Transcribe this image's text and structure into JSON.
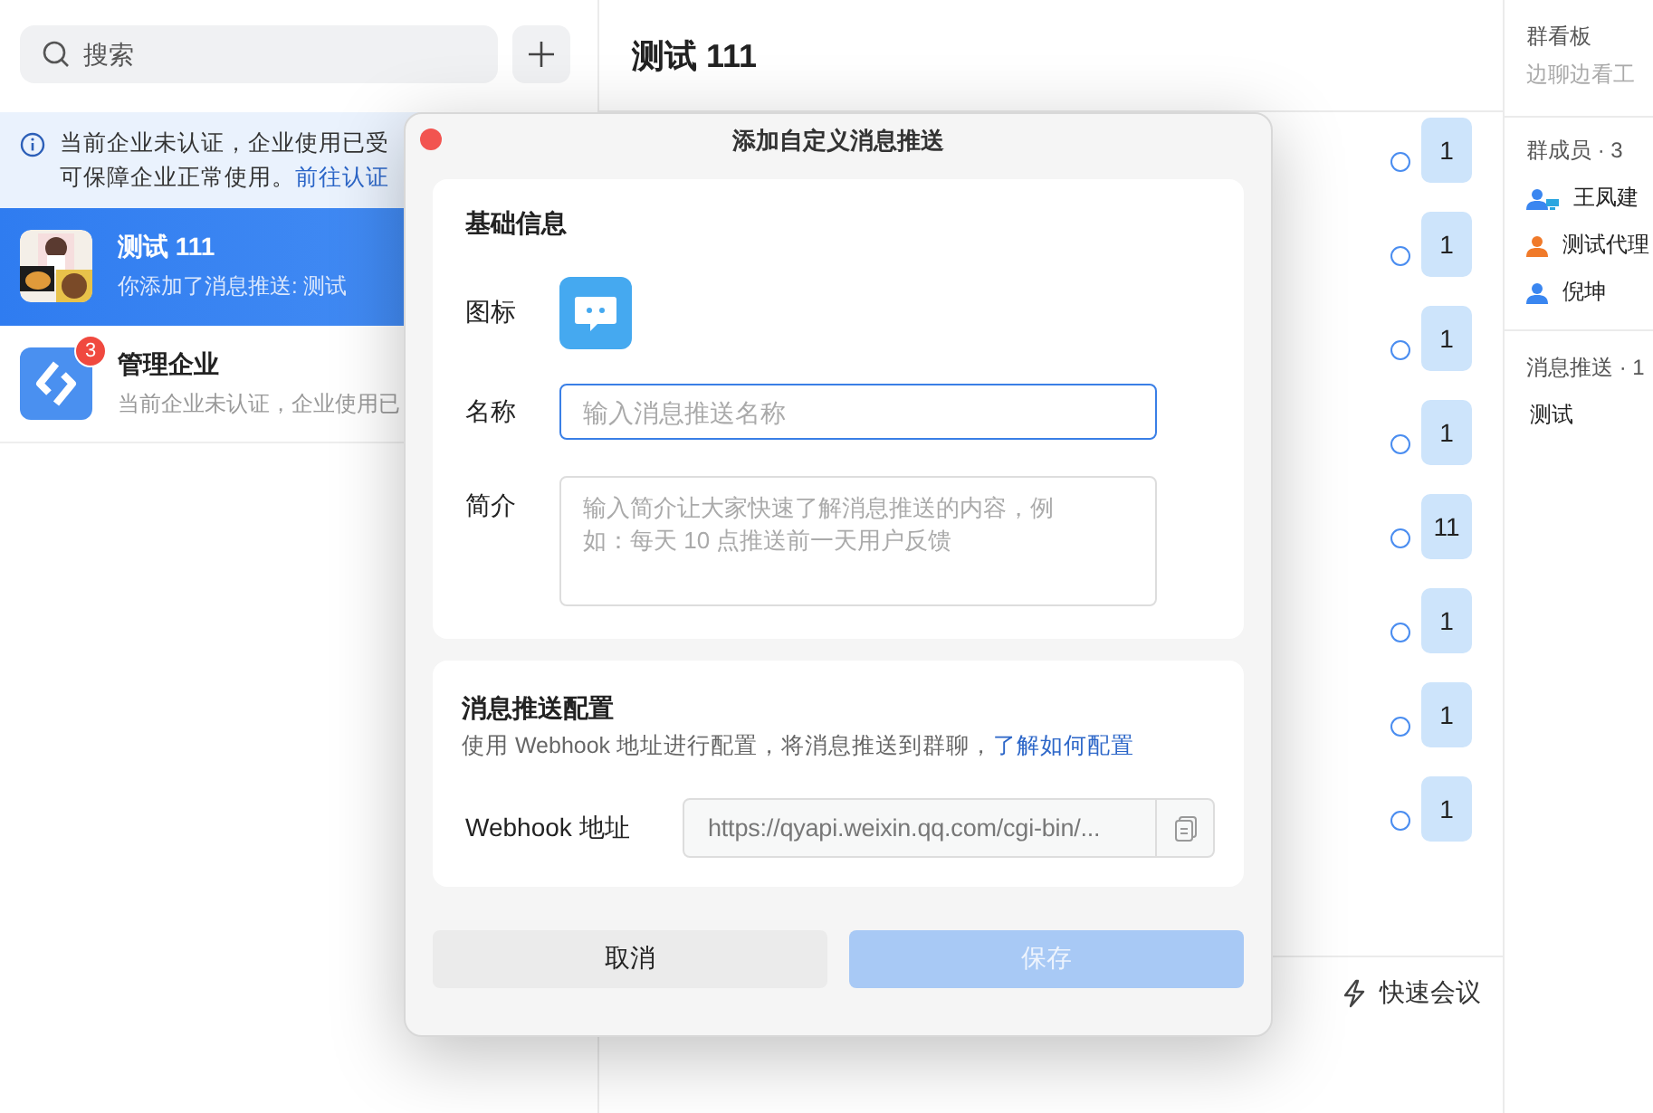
{
  "sidebar": {
    "search": {
      "placeholder": "搜索"
    },
    "notice": {
      "line1": "当前企业未认证，企业使用已受",
      "line2": "可保障企业正常使用。",
      "link": "前往认证"
    },
    "chats": [
      {
        "kind": "picture",
        "title": "测试 111",
        "preview": "你添加了消息推送: 测试",
        "selected": true
      },
      {
        "kind": "logo",
        "title": "管理企业",
        "preview": "当前企业未认证，企业使用已",
        "badge": "3",
        "selected": false
      }
    ]
  },
  "chat": {
    "title": "测试 111",
    "messages": [
      {
        "count": "1"
      },
      {
        "count": "1"
      },
      {
        "count": "1"
      },
      {
        "count": "1"
      },
      {
        "count": "11"
      },
      {
        "count": "1"
      },
      {
        "count": "1"
      },
      {
        "count": "1"
      }
    ],
    "quick_meeting": "快速会议"
  },
  "info_panel": {
    "board": {
      "title": "群看板",
      "subtitle": "边聊边看工"
    },
    "members_title": "群成员 · 3",
    "members": [
      {
        "name": "王凤建",
        "color": "#3a86f0",
        "kind": "desktop"
      },
      {
        "name": "测试代理",
        "color": "#f07a2a",
        "kind": "person"
      },
      {
        "name": "倪坤",
        "color": "#3a86f0",
        "kind": "person"
      }
    ],
    "push_title": "消息推送 · 1",
    "pushes": [
      "测试"
    ]
  },
  "dialog": {
    "title": "添加自定义消息推送",
    "basic": {
      "heading": "基础信息",
      "icon_label": "图标",
      "name_label": "名称",
      "name": {
        "placeholder": "输入消息推送名称",
        "focused": true
      },
      "intro_label": "简介",
      "intro": {
        "placeholder": "输入简介让大家快速了解消息推送的内容，例如：每天 10 点推送前一天用户反馈"
      }
    },
    "config": {
      "heading": "消息推送配置",
      "description": "使用 Webhook 地址进行配置，将消息推送到群聊，",
      "link": "了解如何配置",
      "webhook_label": "Webhook 地址",
      "webhook": "https://qyapi.weixin.qq.com/cgi-bin/..."
    },
    "cancel": "取消",
    "save": {
      "label": "保存",
      "disabled": true
    }
  }
}
